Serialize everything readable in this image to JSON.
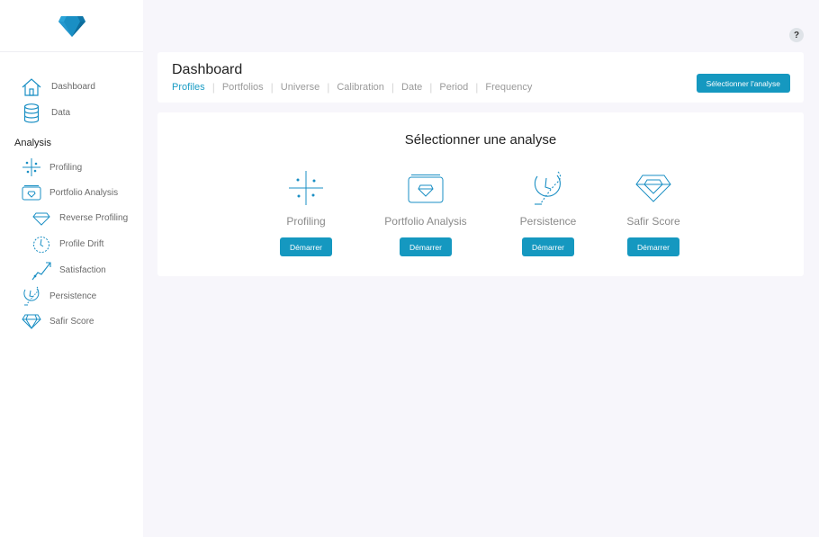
{
  "colors": {
    "accent": "#1598c0",
    "active_tab": "#1a9cc4",
    "background": "#f7f6fb"
  },
  "logo": {
    "icon": "diamond-logo"
  },
  "help": {
    "label": "?"
  },
  "sidebar": {
    "items": [
      {
        "label": "Dashboard",
        "icon": "home-icon"
      },
      {
        "label": "Data",
        "icon": "database-icon"
      }
    ],
    "section_title": "Analysis",
    "analysis_items": [
      {
        "label": "Profiling",
        "icon": "crosshair-icon"
      },
      {
        "label": "Portfolio Analysis",
        "icon": "portfolio-icon"
      },
      {
        "label": "Reverse Profiling",
        "icon": "diamond-icon"
      },
      {
        "label": "Profile Drift",
        "icon": "drift-icon"
      },
      {
        "label": "Satisfaction",
        "icon": "chart-icon"
      },
      {
        "label": "Persistence",
        "icon": "clock-icon"
      },
      {
        "label": "Safir Score",
        "icon": "diamond-icon"
      }
    ]
  },
  "header": {
    "title": "Dashboard",
    "tabs": [
      {
        "label": "Profiles",
        "active": true
      },
      {
        "label": "Portfolios"
      },
      {
        "label": "Universe"
      },
      {
        "label": "Calibration"
      },
      {
        "label": "Date"
      },
      {
        "label": "Period"
      },
      {
        "label": "Frequency"
      }
    ],
    "select_button": "Sélectionner l'analyse"
  },
  "main": {
    "title": "Sélectionner une analyse",
    "analyses": [
      {
        "label": "Profiling",
        "icon": "crosshair-icon",
        "button": "Démarrer"
      },
      {
        "label": "Portfolio Analysis",
        "icon": "portfolio-icon",
        "button": "Démarrer"
      },
      {
        "label": "Persistence",
        "icon": "clock-icon",
        "button": "Démarrer"
      },
      {
        "label": "Safir Score",
        "icon": "diamond-icon",
        "button": "Démarrer"
      }
    ]
  }
}
